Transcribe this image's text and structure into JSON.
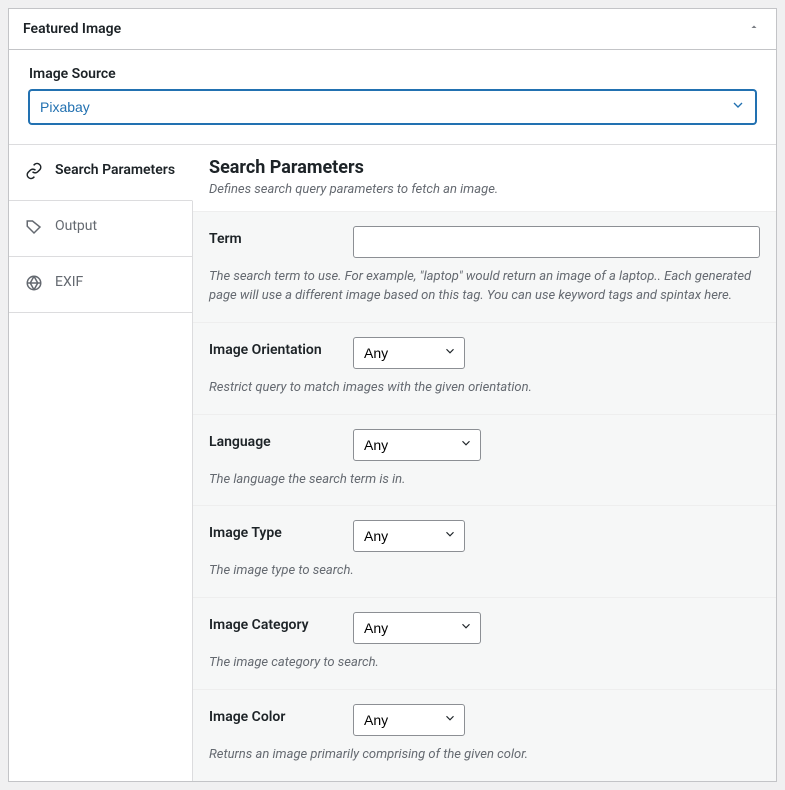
{
  "box_title": "Featured Image",
  "source": {
    "label": "Image Source",
    "value": "Pixabay"
  },
  "tabs": [
    {
      "label": "Search Parameters"
    },
    {
      "label": "Output"
    },
    {
      "label": "EXIF"
    }
  ],
  "section": {
    "title": "Search Parameters",
    "desc": "Defines search query parameters to fetch an image."
  },
  "fields": {
    "term": {
      "label": "Term",
      "value": "",
      "help": "The search term to use. For example, \"laptop\" would return an image of a laptop.. Each generated page will use a different image based on this tag. You can use keyword tags and spintax here."
    },
    "orientation": {
      "label": "Image Orientation",
      "value": "Any",
      "help": "Restrict query to match images with the given orientation."
    },
    "language": {
      "label": "Language",
      "value": "Any",
      "help": "The language the search term is in."
    },
    "type": {
      "label": "Image Type",
      "value": "Any",
      "help": "The image type to search."
    },
    "category": {
      "label": "Image Category",
      "value": "Any",
      "help": "The image category to search."
    },
    "color": {
      "label": "Image Color",
      "value": "Any",
      "help": "Returns an image primarily comprising of the given color."
    }
  }
}
